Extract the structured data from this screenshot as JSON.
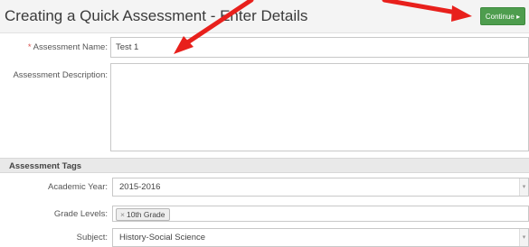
{
  "page": {
    "title": "Creating a Quick Assessment - Enter Details",
    "continue_label": "Continue ▸"
  },
  "form": {
    "required_marker": "*",
    "name_label": "Assessment Name:",
    "name_value": "Test 1",
    "description_label": "Assessment Description:",
    "description_value": ""
  },
  "tags_section": {
    "title": "Assessment Tags",
    "academic_year_label": "Academic Year:",
    "academic_year_value": "2015-2016",
    "grade_levels_label": "Grade Levels:",
    "grade_tag_remove": "×",
    "grade_tag": "10th Grade",
    "subject_label": "Subject:",
    "subject_value": "History-Social Science",
    "dropdown_arrow": "▾"
  },
  "annotation": {
    "arrow_color": "#e8201c"
  }
}
